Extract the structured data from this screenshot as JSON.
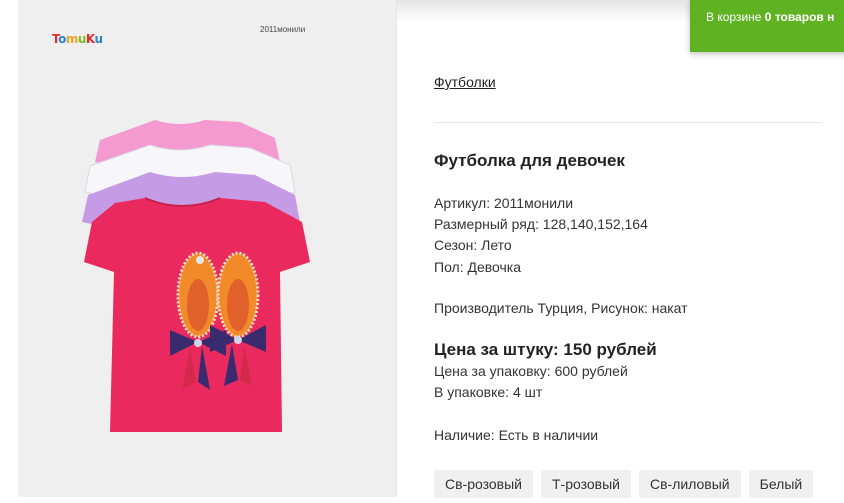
{
  "image": {
    "brand": "TomuKu",
    "code": "2011монили"
  },
  "cart": {
    "prefix": "В корзине",
    "count": "0",
    "suffix": "товаров н"
  },
  "product": {
    "category": "Футболки",
    "title": "Футболка для девочек",
    "article": "Артикул: 2011монили",
    "sizes": "Размерный ряд: 128,140,152,164",
    "season": "Сезон: Лето",
    "gender": "Пол: Девочка",
    "maker": "Производитель Турция, Рисунок: накат",
    "price_unit": "Цена за штуку: 150 рублей",
    "price_pack": "Цена за упаковку: 600 рублей",
    "pack_qty": "В упаковке: 4 шт",
    "availability": "Наличие: Есть в наличии"
  },
  "variants": [
    "Св-розовый",
    "Т-розовый",
    "Св-лиловый",
    "Белый"
  ],
  "colors": {
    "cart_green": "#5fb323",
    "shirt_pink_light": "#f49ad0",
    "shirt_white": "#f7f7fb",
    "shirt_lilac": "#c59be6",
    "shirt_main": "#ea2a5e"
  }
}
